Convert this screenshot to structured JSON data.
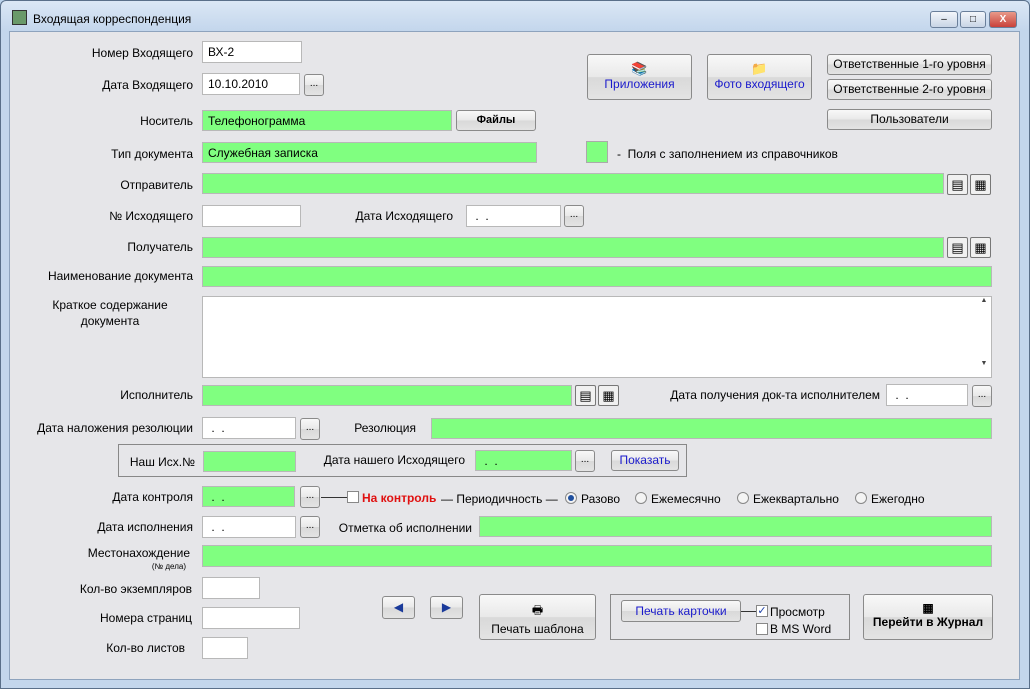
{
  "window": {
    "title": "Входящая корреспонденция",
    "minimize": "–",
    "maximize": "□",
    "close": "X",
    "close_color": "#c9413a"
  },
  "colors": {
    "lookup_field": "#80ff80",
    "form_bg": "#e6e6e9",
    "link_blue": "#1a1acc",
    "control_red": "#e01010"
  },
  "fields": {
    "incoming_number": {
      "label": "Номер Входящего",
      "value": "ВХ-2"
    },
    "incoming_date": {
      "label": "Дата Входящего",
      "value": "10.10.2010"
    },
    "carrier": {
      "label": "Носитель",
      "value": "Телефонограмма"
    },
    "doc_type": {
      "label": "Тип документа",
      "value": "Служебная записка"
    },
    "sender": {
      "label": "Отправитель",
      "value": ""
    },
    "outgoing_number": {
      "label": "№ Исходящего",
      "value": ""
    },
    "outgoing_date": {
      "label": "Дата Исходящего",
      "value": " .  ."
    },
    "recipient": {
      "label": "Получатель",
      "value": ""
    },
    "doc_name": {
      "label": "Наименование документа",
      "value": ""
    },
    "summary": {
      "label": "Краткое содержание документа",
      "value": ""
    },
    "executor": {
      "label": "Исполнитель",
      "value": ""
    },
    "executor_received_date": {
      "label": "Дата получения док-та исполнителем",
      "value": " .  ."
    },
    "resolution_date": {
      "label": "Дата наложения резолюции",
      "value": " .  ."
    },
    "resolution": {
      "label": "Резолюция",
      "value": ""
    },
    "our_out_number": {
      "label": "Наш Исх.№",
      "value": ""
    },
    "our_out_date": {
      "label": "Дата нашего Исходящего",
      "value": " .  ."
    },
    "control_date": {
      "label": "Дата контроля",
      "value": " .  ."
    },
    "execution_date": {
      "label": "Дата исполнения",
      "value": " .  ."
    },
    "execution_mark": {
      "label": "Отметка об исполнении",
      "value": ""
    },
    "location": {
      "label": "Местонахождение",
      "sublabel": "(№ дела)",
      "value": ""
    },
    "copies": {
      "label": "Кол-во экземпляров",
      "value": ""
    },
    "page_numbers": {
      "label": "Номера страниц",
      "value": ""
    },
    "sheets": {
      "label": "Кол-во листов",
      "value": ""
    }
  },
  "legend": {
    "text": "-  Поля с заполнением из справочников"
  },
  "buttons": {
    "dots": "...",
    "files": "Файлы",
    "attachments": "Приложения",
    "photo": "Фото входящего",
    "resp1": "Ответственные 1-го уровня",
    "resp2": "Ответственные 2-го уровня",
    "users": "Пользователи",
    "show": "Показать",
    "print_template": "Печать шаблона",
    "print_card": "Печать карточки",
    "go_journal": "Перейти в Журнал"
  },
  "control": {
    "checkbox_label": "На контроль",
    "checked": false,
    "periodicity_label": "— Периодичность —",
    "options": [
      "Разово",
      "Ежемесячно",
      "Ежеквартально",
      "Ежегодно"
    ],
    "selected": "Разово"
  },
  "print_options": {
    "preview": {
      "label": "Просмотр",
      "checked": true
    },
    "ms_word": {
      "label": "В MS Word",
      "checked": false
    }
  },
  "icons": {
    "lookup": "address-book-icon",
    "table": "table-grid-icon",
    "prev": "arrow-left-icon",
    "next": "arrow-right-icon",
    "printer": "printer-icon"
  }
}
